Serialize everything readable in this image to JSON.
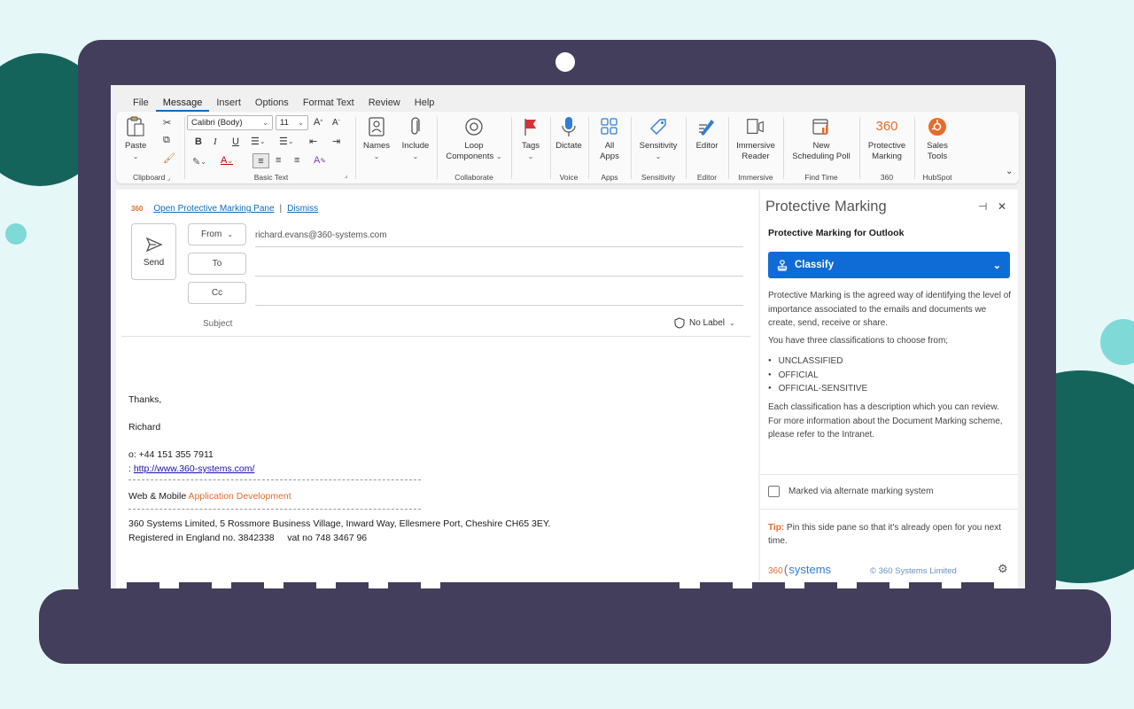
{
  "menu": {
    "tabs": [
      "File",
      "Message",
      "Insert",
      "Options",
      "Format Text",
      "Review",
      "Help"
    ],
    "active": "Message"
  },
  "ribbon": {
    "clipboard": {
      "paste": "Paste",
      "group": "Clipboard"
    },
    "basic_text": {
      "font": "Calibri (Body)",
      "size": "11",
      "group": "Basic Text"
    },
    "names": {
      "label": "Names"
    },
    "include": {
      "label": "Include"
    },
    "collaborate": {
      "label_1": "Loop",
      "label_2": "Components",
      "group": "Collaborate"
    },
    "tags": {
      "label": "Tags"
    },
    "voice": {
      "label": "Dictate",
      "group": "Voice"
    },
    "apps": {
      "label_1": "All",
      "label_2": "Apps",
      "group": "Apps"
    },
    "sensitivity": {
      "label": "Sensitivity",
      "group": "Sensitivity"
    },
    "editor": {
      "label": "Editor",
      "group": "Editor"
    },
    "immersive": {
      "label_1": "Immersive",
      "label_2": "Reader",
      "group": "Immersive"
    },
    "find_time": {
      "label_1": "New",
      "label_2": "Scheduling Poll",
      "group": "Find Time"
    },
    "marking360": {
      "icon_text": "360",
      "label_1": "Protective",
      "label_2": "Marking",
      "group": "360"
    },
    "hubspot": {
      "label_1": "Sales",
      "label_2": "Tools",
      "group": "HubSpot"
    }
  },
  "compose": {
    "logo": "360",
    "open_pane_link": "Open Protective Marking Pane",
    "separator": "|",
    "dismiss_link": "Dismiss",
    "send_label": "Send",
    "from_label": "From",
    "from_address": "richard.evans@360-systems.com",
    "to_label": "To",
    "cc_label": "Cc",
    "subject_label": "Subject",
    "no_label": "No Label",
    "body": {
      "thanks": "Thanks,",
      "name": "Richard",
      "phone": "o: +44 151 355 7911",
      "web_prefix": ": ",
      "web_link": "http://www.360-systems.com/",
      "tagline_plain": "Web & Mobile ",
      "tagline_orange": "Application Development",
      "address": "360 Systems Limited, 5 Rossmore Business Village, Inward Way, Ellesmere Port, Cheshire CH65 3EY.",
      "registered": "Registered in England no. 3842338     vat no 748 3467 96"
    }
  },
  "pane": {
    "title": "Protective Marking",
    "subtitle": "Protective Marking for Outlook",
    "classify": "Classify",
    "intro": "Protective Marking is the agreed way of identifying the level of importance associated to the emails and documents we create, send, receive or share.",
    "choose": "You have three classifications to choose from;",
    "classifications": [
      "UNCLASSIFIED",
      "OFFICIAL",
      "OFFICIAL-SENSITIVE"
    ],
    "description": "Each classification has a description which you can review. For more information about the Document Marking scheme, please refer to the Intranet.",
    "checkbox_label": "Marked via alternate marking system",
    "tip_label": "Tip:",
    "tip_text": " Pin this side pane so that it's already open for you next time.",
    "footer_logo_num": "360",
    "footer_logo_word": "systems",
    "footer_copyright": "© 360 Systems Limited"
  },
  "colors": {
    "accent": "#0f6cd6",
    "brand_orange": "#e56d2b",
    "laptop": "#433e5b",
    "teal_dark": "#14645c",
    "teal_light": "#7ed9d7"
  }
}
